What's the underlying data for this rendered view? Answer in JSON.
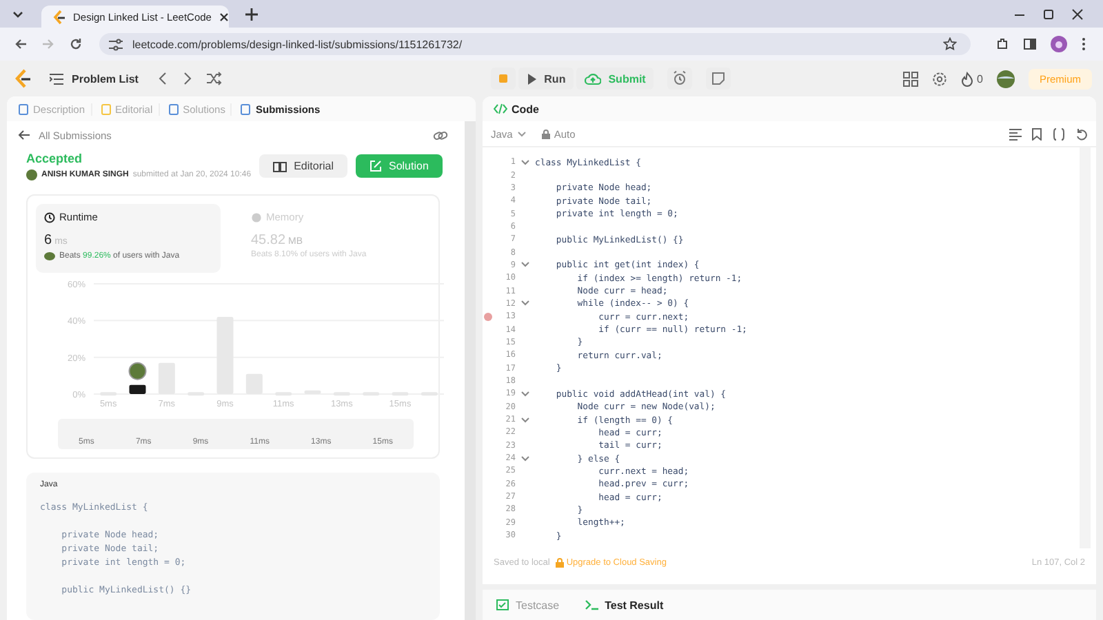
{
  "browser": {
    "tab_title": "Design Linked List - LeetCode",
    "url": "leetcode.com/problems/design-linked-list/submissions/1151261732/"
  },
  "nav": {
    "problem_list": "Problem List",
    "run": "Run",
    "submit": "Submit",
    "streak": "0",
    "premium": "Premium"
  },
  "left": {
    "tabs": [
      {
        "label": "Description",
        "selected": false
      },
      {
        "label": "Editorial",
        "selected": false
      },
      {
        "label": "Solutions",
        "selected": false
      },
      {
        "label": "Submissions",
        "selected": true
      }
    ],
    "back": "All Submissions",
    "status": "Accepted",
    "user": "ANISH KUMAR SINGH",
    "submitted": "submitted at Jan 20, 2024 10:46",
    "editorial_button": "Editorial",
    "solution_button": "Solution",
    "stats": [
      {
        "kind": "runtime",
        "label": "Runtime",
        "value": "6",
        "unit": "ms",
        "beats": "Beats **99.26%** of users with Java",
        "selected": true
      },
      {
        "kind": "memory",
        "label": "Memory",
        "value": "45.82",
        "unit": "MB",
        "beats": "Beats **8.10%** of users with Java",
        "selected": false
      }
    ],
    "chart_data": {
      "type": "bar",
      "x": [
        5,
        6,
        7,
        8,
        9,
        10,
        11,
        12,
        13,
        14,
        15,
        16
      ],
      "values": [
        1,
        5,
        17,
        1,
        42,
        11,
        1,
        2,
        1,
        1,
        1,
        1
      ],
      "xlim": [
        4.5,
        16.5
      ],
      "ylim": [
        0,
        60
      ],
      "yticks": [
        {
          "value": 0,
          "label": "0%"
        },
        {
          "value": 20,
          "label": "20%"
        },
        {
          "value": 40,
          "label": "40%"
        },
        {
          "value": 60,
          "label": "60%"
        }
      ],
      "xticks": [
        {
          "value": 5,
          "label": "5ms"
        },
        {
          "value": 7,
          "label": "7ms"
        },
        {
          "value": 9,
          "label": "9ms"
        },
        {
          "value": 11,
          "label": "11ms"
        },
        {
          "value": 13,
          "label": "13ms"
        },
        {
          "value": 15,
          "label": "15ms"
        }
      ]
    },
    "brush_labels": [
      "5ms",
      "7ms",
      "9ms",
      "11ms",
      "13ms",
      "15ms"
    ],
    "code_card": {
      "language": "Java",
      "lines": [
        {
          "text": "class MyLinkedList {"
        },
        {
          "text": "    private Node head;",
          "blank_before": true
        },
        {
          "text": "    private Node tail;"
        },
        {
          "text": "    private int length = 0;"
        },
        {
          "text": "    public MyLinkedList() {}",
          "blank_before": true
        }
      ]
    }
  },
  "right": {
    "title": "Code",
    "language": "Java",
    "mode": "Auto",
    "lines": [
      {
        "n": "1",
        "text": "class MyLinkedList {",
        "fold": true,
        "breakpoint": false
      },
      {
        "n": "2",
        "fold": false,
        "breakpoint": false
      },
      {
        "n": "3",
        "text": "    private Node head;",
        "fold": false,
        "breakpoint": false
      },
      {
        "n": "4",
        "text": "    private Node tail;",
        "fold": false,
        "breakpoint": false
      },
      {
        "n": "5",
        "text": "    private int length = 0;",
        "fold": false,
        "breakpoint": false
      },
      {
        "n": "6",
        "fold": false,
        "breakpoint": false
      },
      {
        "n": "7",
        "text": "    public MyLinkedList() {}",
        "fold": false,
        "breakpoint": false
      },
      {
        "n": "8",
        "fold": false,
        "breakpoint": false
      },
      {
        "n": "9",
        "text": "    public int get(int index) {",
        "fold": true,
        "breakpoint": false
      },
      {
        "n": "10",
        "text": "        if (index >= length) return -1;",
        "fold": false,
        "breakpoint": false
      },
      {
        "n": "11",
        "text": "        Node curr = head;",
        "fold": false,
        "breakpoint": false
      },
      {
        "n": "12",
        "text": "        while (index-- > 0) {",
        "fold": true,
        "breakpoint": false
      },
      {
        "n": "13",
        "text": "            curr = curr.next;",
        "fold": false,
        "breakpoint": true
      },
      {
        "n": "14",
        "text": "            if (curr == null) return -1;",
        "fold": false,
        "breakpoint": false
      },
      {
        "n": "15",
        "text": "        }",
        "fold": false,
        "breakpoint": false
      },
      {
        "n": "16",
        "text": "        return curr.val;",
        "fold": false,
        "breakpoint": false
      },
      {
        "n": "17",
        "text": "    }",
        "fold": false,
        "breakpoint": false
      },
      {
        "n": "18",
        "fold": false,
        "breakpoint": false
      },
      {
        "n": "19",
        "text": "    public void addAtHead(int val) {",
        "fold": true,
        "breakpoint": false
      },
      {
        "n": "20",
        "text": "        Node curr = new Node(val);",
        "fold": false,
        "breakpoint": false
      },
      {
        "n": "21",
        "text": "        if (length == 0) {",
        "fold": true,
        "breakpoint": false
      },
      {
        "n": "22",
        "text": "            head = curr;",
        "fold": false,
        "breakpoint": false
      },
      {
        "n": "23",
        "text": "            tail = curr;",
        "fold": false,
        "breakpoint": false
      },
      {
        "n": "24",
        "text": "        } else {",
        "fold": true,
        "breakpoint": false
      },
      {
        "n": "25",
        "text": "            curr.next = head;",
        "fold": false,
        "breakpoint": false
      },
      {
        "n": "26",
        "text": "            head.prev = curr;",
        "fold": false,
        "breakpoint": false
      },
      {
        "n": "27",
        "text": "            head = curr;",
        "fold": false,
        "breakpoint": false
      },
      {
        "n": "28",
        "text": "        }",
        "fold": false,
        "breakpoint": false
      },
      {
        "n": "29",
        "text": "        length++;",
        "fold": false,
        "breakpoint": false
      },
      {
        "n": "30",
        "text": "    }",
        "fold": false,
        "breakpoint": false
      }
    ],
    "saved": "Saved to local",
    "upgrade": "Upgrade to Cloud Saving",
    "position": "Ln 107, Col 2",
    "bottom_tabs": [
      {
        "label": "Testcase",
        "selected": false
      },
      {
        "label": "Test Result",
        "selected": true
      }
    ]
  }
}
